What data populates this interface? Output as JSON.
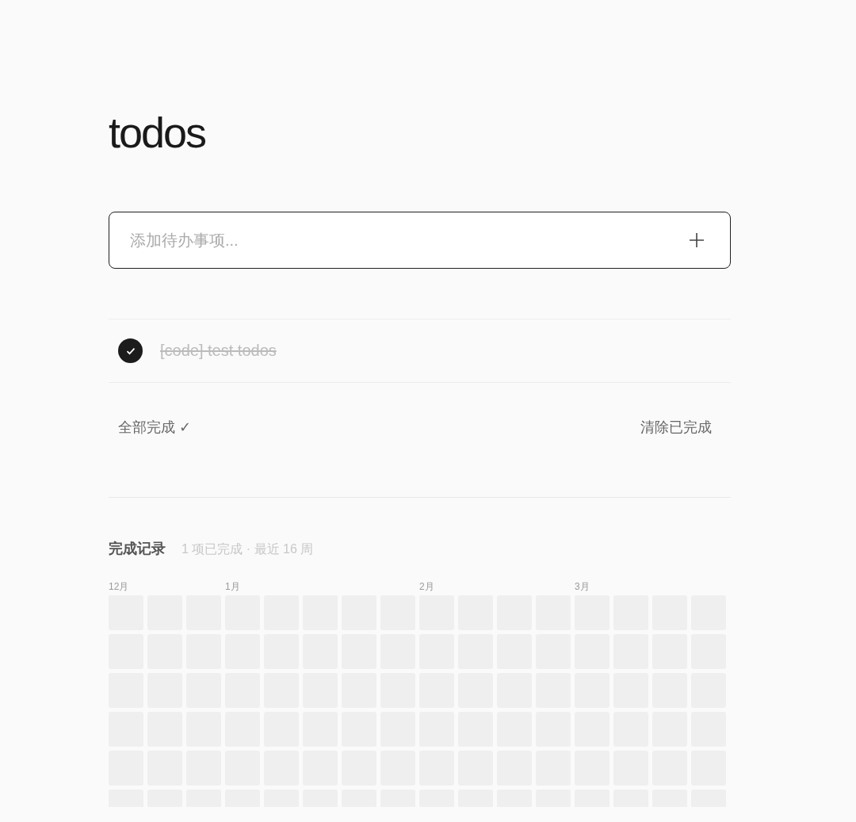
{
  "title": "todos",
  "new_todo": {
    "placeholder": "添加待办事项..."
  },
  "todos": [
    {
      "text": "[code] test todos",
      "completed": true
    }
  ],
  "footer": {
    "complete_all": "全部完成 ✓",
    "clear_completed": "清除已完成"
  },
  "history": {
    "title": "完成记录",
    "summary": "1 项已完成 · 最近 16 周",
    "weeks": [
      {
        "kind": "month_start",
        "label": "12月"
      },
      {
        "kind": "week"
      },
      {
        "kind": "week"
      },
      {
        "kind": "month_start",
        "label": "1月"
      },
      {
        "kind": "week"
      },
      {
        "kind": "week"
      },
      {
        "kind": "week"
      },
      {
        "kind": "week"
      },
      {
        "kind": "month_start",
        "label": "2月"
      },
      {
        "kind": "week"
      },
      {
        "kind": "week"
      },
      {
        "kind": "week"
      },
      {
        "kind": "month_start",
        "label": "3月"
      },
      {
        "kind": "week"
      },
      {
        "kind": "week"
      },
      {
        "kind": "week"
      }
    ]
  }
}
